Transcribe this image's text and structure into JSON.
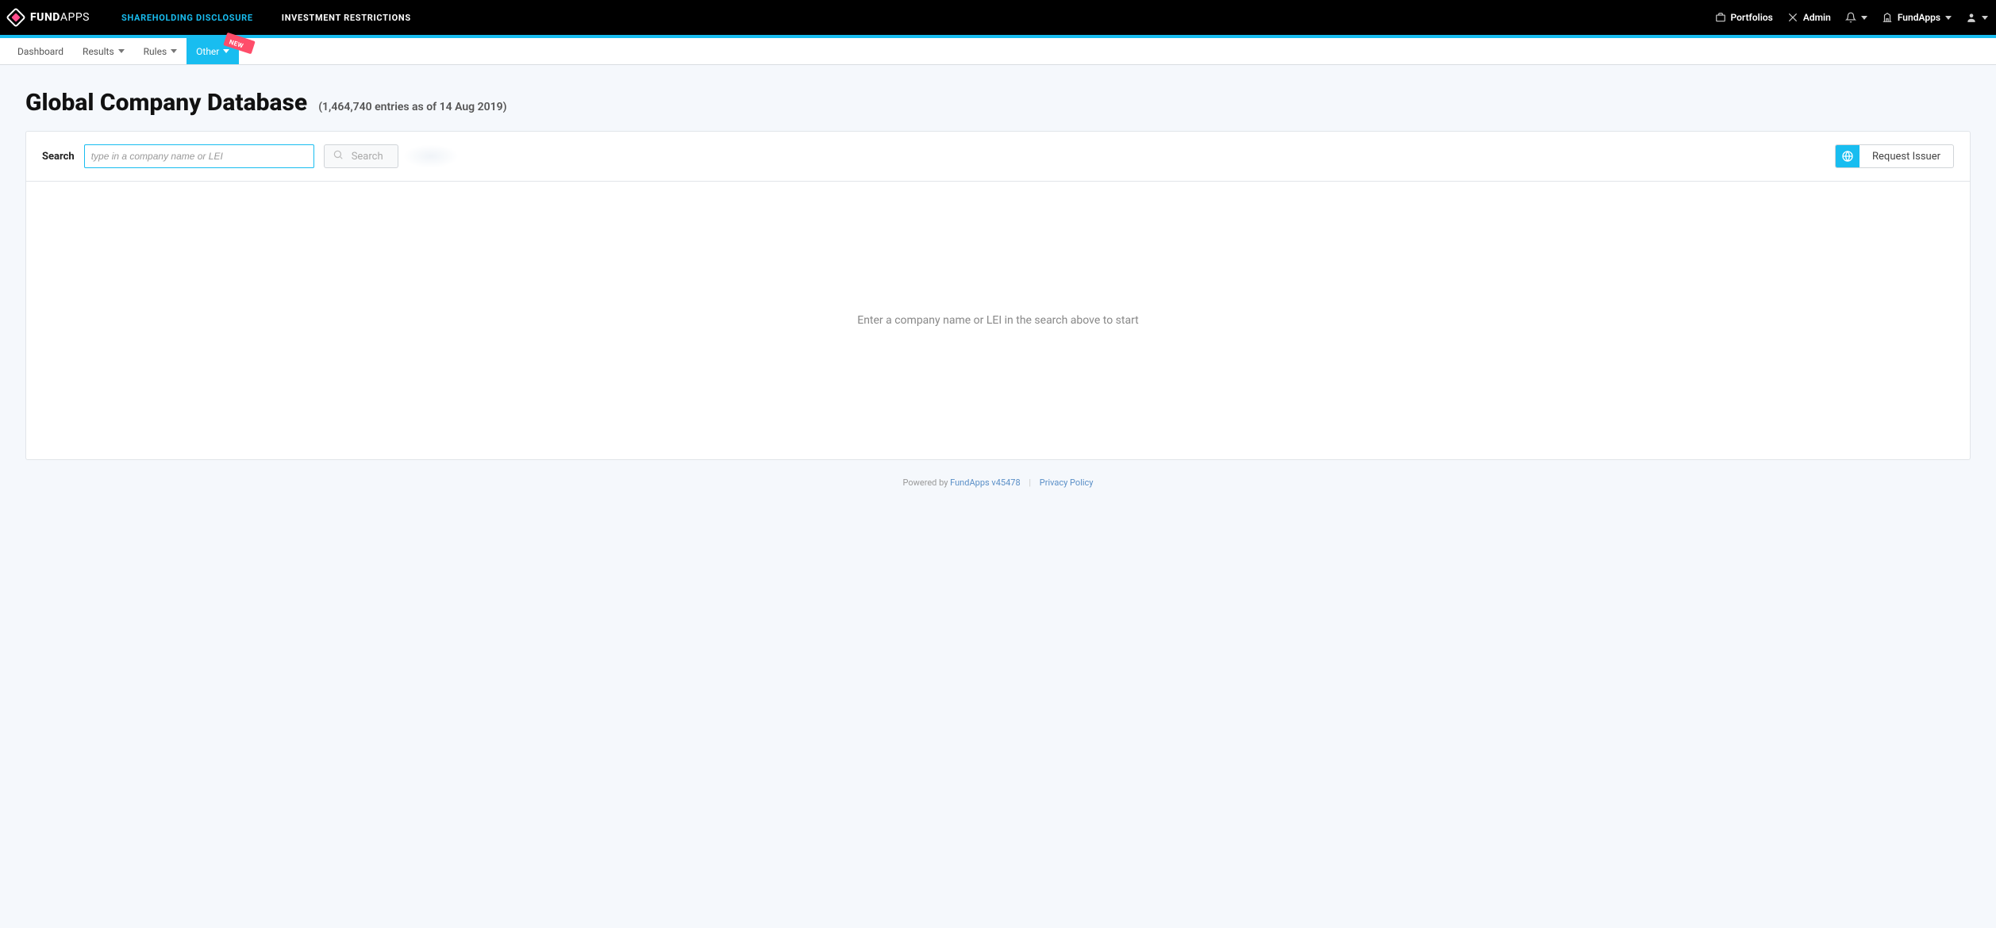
{
  "brand": {
    "name_bold": "FUND",
    "name_thin": "APPS"
  },
  "top_nav": {
    "shareholding": "SHAREHOLDING DISCLOSURE",
    "investment": "INVESTMENT RESTRICTIONS"
  },
  "top_right": {
    "portfolios": "Portfolios",
    "admin": "Admin",
    "org": "FundApps"
  },
  "subnav": {
    "dashboard": "Dashboard",
    "results": "Results",
    "rules": "Rules",
    "other": "Other",
    "new_badge": "NEW"
  },
  "page": {
    "title": "Global Company Database",
    "subtitle": "(1,464,740 entries as of 14 Aug 2019)"
  },
  "search": {
    "label": "Search",
    "placeholder": "type in a company name or LEI",
    "button": "Search",
    "request_issuer": "Request Issuer"
  },
  "placeholder_text": "Enter a company name or LEI in the search above to start",
  "footer": {
    "powered_by": "Powered by ",
    "link": "FundApps v45478",
    "privacy": "Privacy Policy"
  }
}
